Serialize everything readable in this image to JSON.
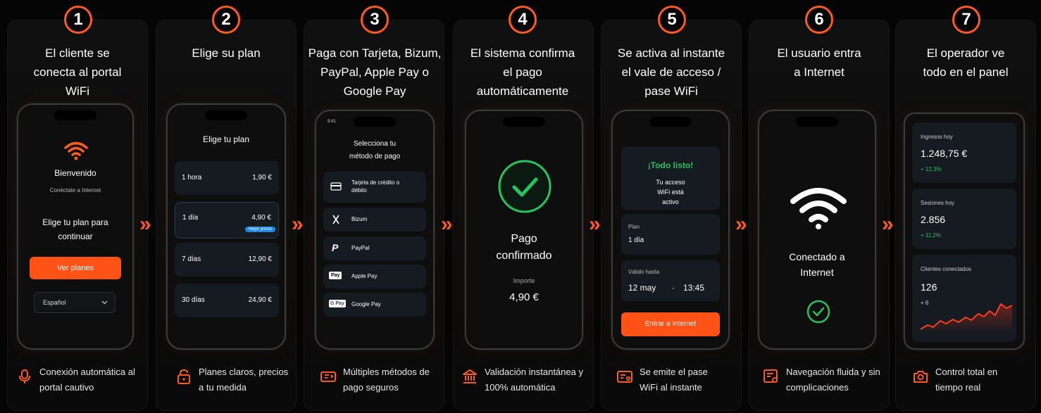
{
  "steps": [
    {
      "num": "1",
      "title": "El cliente se conecta al portal WiFi",
      "feature": "Conexión automática al portal cautivo",
      "feature_icon": "microphone-icon"
    },
    {
      "num": "2",
      "title": "Elige su plan",
      "feature": "Planes claros, precios a tu medida",
      "feature_icon": "lock-icon"
    },
    {
      "num": "3",
      "title": "Paga con Tarjeta, Bizum, PayPal, Apple Pay o Google Pay",
      "feature": "Múltiples métodos de pago seguros",
      "feature_icon": "payment-icon"
    },
    {
      "num": "4",
      "title": "El sistema confirma el pago automáticamente",
      "feature": "Validación instantánea y 100% automática",
      "feature_icon": "bank-icon"
    },
    {
      "num": "5",
      "title": "Se activa al instante el vale de acceso / pase WiFi",
      "feature": "Se emite el pase WiFi al instante",
      "feature_icon": "ticket-icon"
    },
    {
      "num": "6",
      "title": "El usuario entra a Internet",
      "feature": "Navegación fluida y sin complicaciones",
      "feature_icon": "browser-icon"
    },
    {
      "num": "7",
      "title": "El operador ve todo en el panel",
      "feature": "Control total en tiempo real",
      "feature_icon": "camera-icon"
    }
  ],
  "phone1": {
    "welcome": "Bienvenido",
    "subtitle": "Conéctate a Internet",
    "prompt": "Elige tu plan para continuar",
    "button": "Ver planes",
    "language": "Español"
  },
  "phone2": {
    "title": "Elige tu plan",
    "badge": "Mejor precio",
    "plans": [
      {
        "name": "1 hora",
        "price": "1,90 €"
      },
      {
        "name": "1 día",
        "price": "4,90 €"
      },
      {
        "name": "7 días",
        "price": "12,90 €"
      },
      {
        "name": "30 días",
        "price": "24,90 €"
      }
    ]
  },
  "phone3": {
    "status_time": "9:41",
    "title": "Selecciona tu método de pago",
    "methods": [
      {
        "label": "Tarjeta de crédito o débito",
        "icon": "credit-card-icon"
      },
      {
        "label": "Bizum",
        "icon": "bizum-icon"
      },
      {
        "label": "PayPal",
        "icon": "paypal-icon"
      },
      {
        "label": "Apple Pay",
        "icon": "apple-pay-icon",
        "icon_text": "Pay"
      },
      {
        "label": "Google Pay",
        "icon": "google-pay-icon",
        "icon_text": "G Pay"
      }
    ]
  },
  "phone4": {
    "title": "Pago confirmado",
    "amount_label": "Importe",
    "amount": "4,90 €"
  },
  "phone5": {
    "ready": "¡Todo listo!",
    "message": "Tu acceso WiFi está activo",
    "plan_label": "Plan",
    "plan_value": "1 día",
    "valid_label": "Válido hasta",
    "valid_date": "12 may",
    "valid_sep": "·",
    "valid_time": "13:45",
    "button": "Entrar a Internet"
  },
  "phone6": {
    "status": "Conectado a Internet"
  },
  "phone7": {
    "income_label": "Ingresos hoy",
    "income_value": "1.248,75 €",
    "income_delta": "+ 12,3%",
    "sessions_label": "Sesiones hoy",
    "sessions_value": "2.856",
    "sessions_delta": "+ 11,2%",
    "clients_label": "Clientes conectados",
    "clients_value": "126",
    "clients_delta": "+ 6"
  },
  "colors": {
    "accent": "#ff5a1f",
    "success": "#22c55e",
    "badge": "#1e88e5"
  }
}
